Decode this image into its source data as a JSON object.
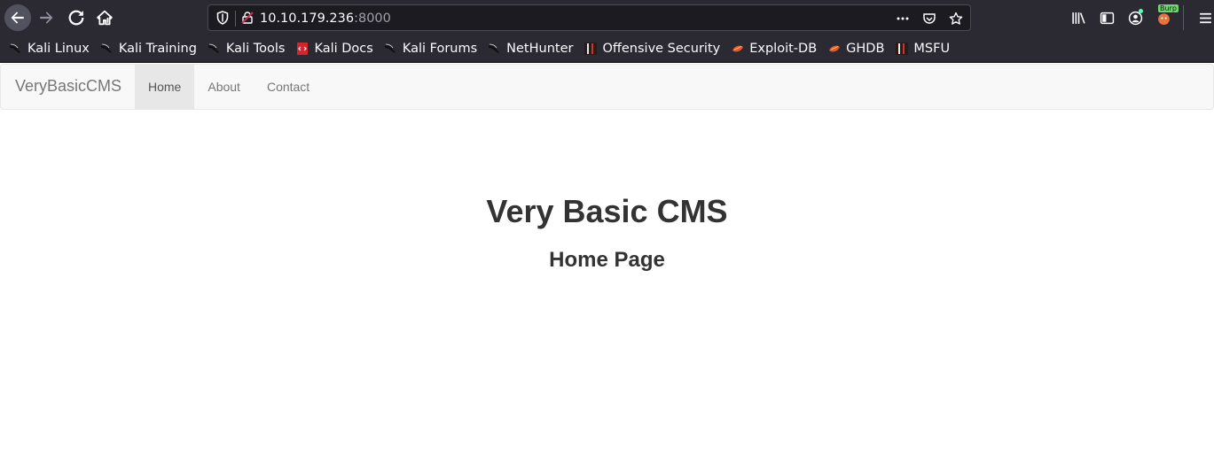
{
  "browser": {
    "url_host": "10.10.179.236",
    "url_port": ":8000",
    "burp_badge": "Burp"
  },
  "bookmarks": [
    {
      "label": "Kali Linux",
      "icon": "kali-dragon-icon"
    },
    {
      "label": "Kali Training",
      "icon": "kali-dragon-icon"
    },
    {
      "label": "Kali Tools",
      "icon": "kali-dragon-icon"
    },
    {
      "label": "Kali Docs",
      "icon": "docs-icon"
    },
    {
      "label": "Kali Forums",
      "icon": "kali-dragon-icon"
    },
    {
      "label": "NetHunter",
      "icon": "kali-dragon-icon"
    },
    {
      "label": "Offensive Security",
      "icon": "offsec-icon"
    },
    {
      "label": "Exploit-DB",
      "icon": "exploitdb-icon"
    },
    {
      "label": "GHDB",
      "icon": "exploitdb-icon"
    },
    {
      "label": "MSFU",
      "icon": "offsec-icon"
    }
  ],
  "site": {
    "brand": "VeryBasicCMS",
    "nav": [
      {
        "label": "Home",
        "active": true
      },
      {
        "label": "About",
        "active": false
      },
      {
        "label": "Contact",
        "active": false
      }
    ],
    "heading": "Very Basic CMS",
    "subheading": "Home Page"
  },
  "colors": {
    "chrome_bg": "#2b2a33",
    "navbar_bg": "#f8f8f8",
    "nav_active_bg": "#e7e7e7",
    "text": "#333333"
  }
}
